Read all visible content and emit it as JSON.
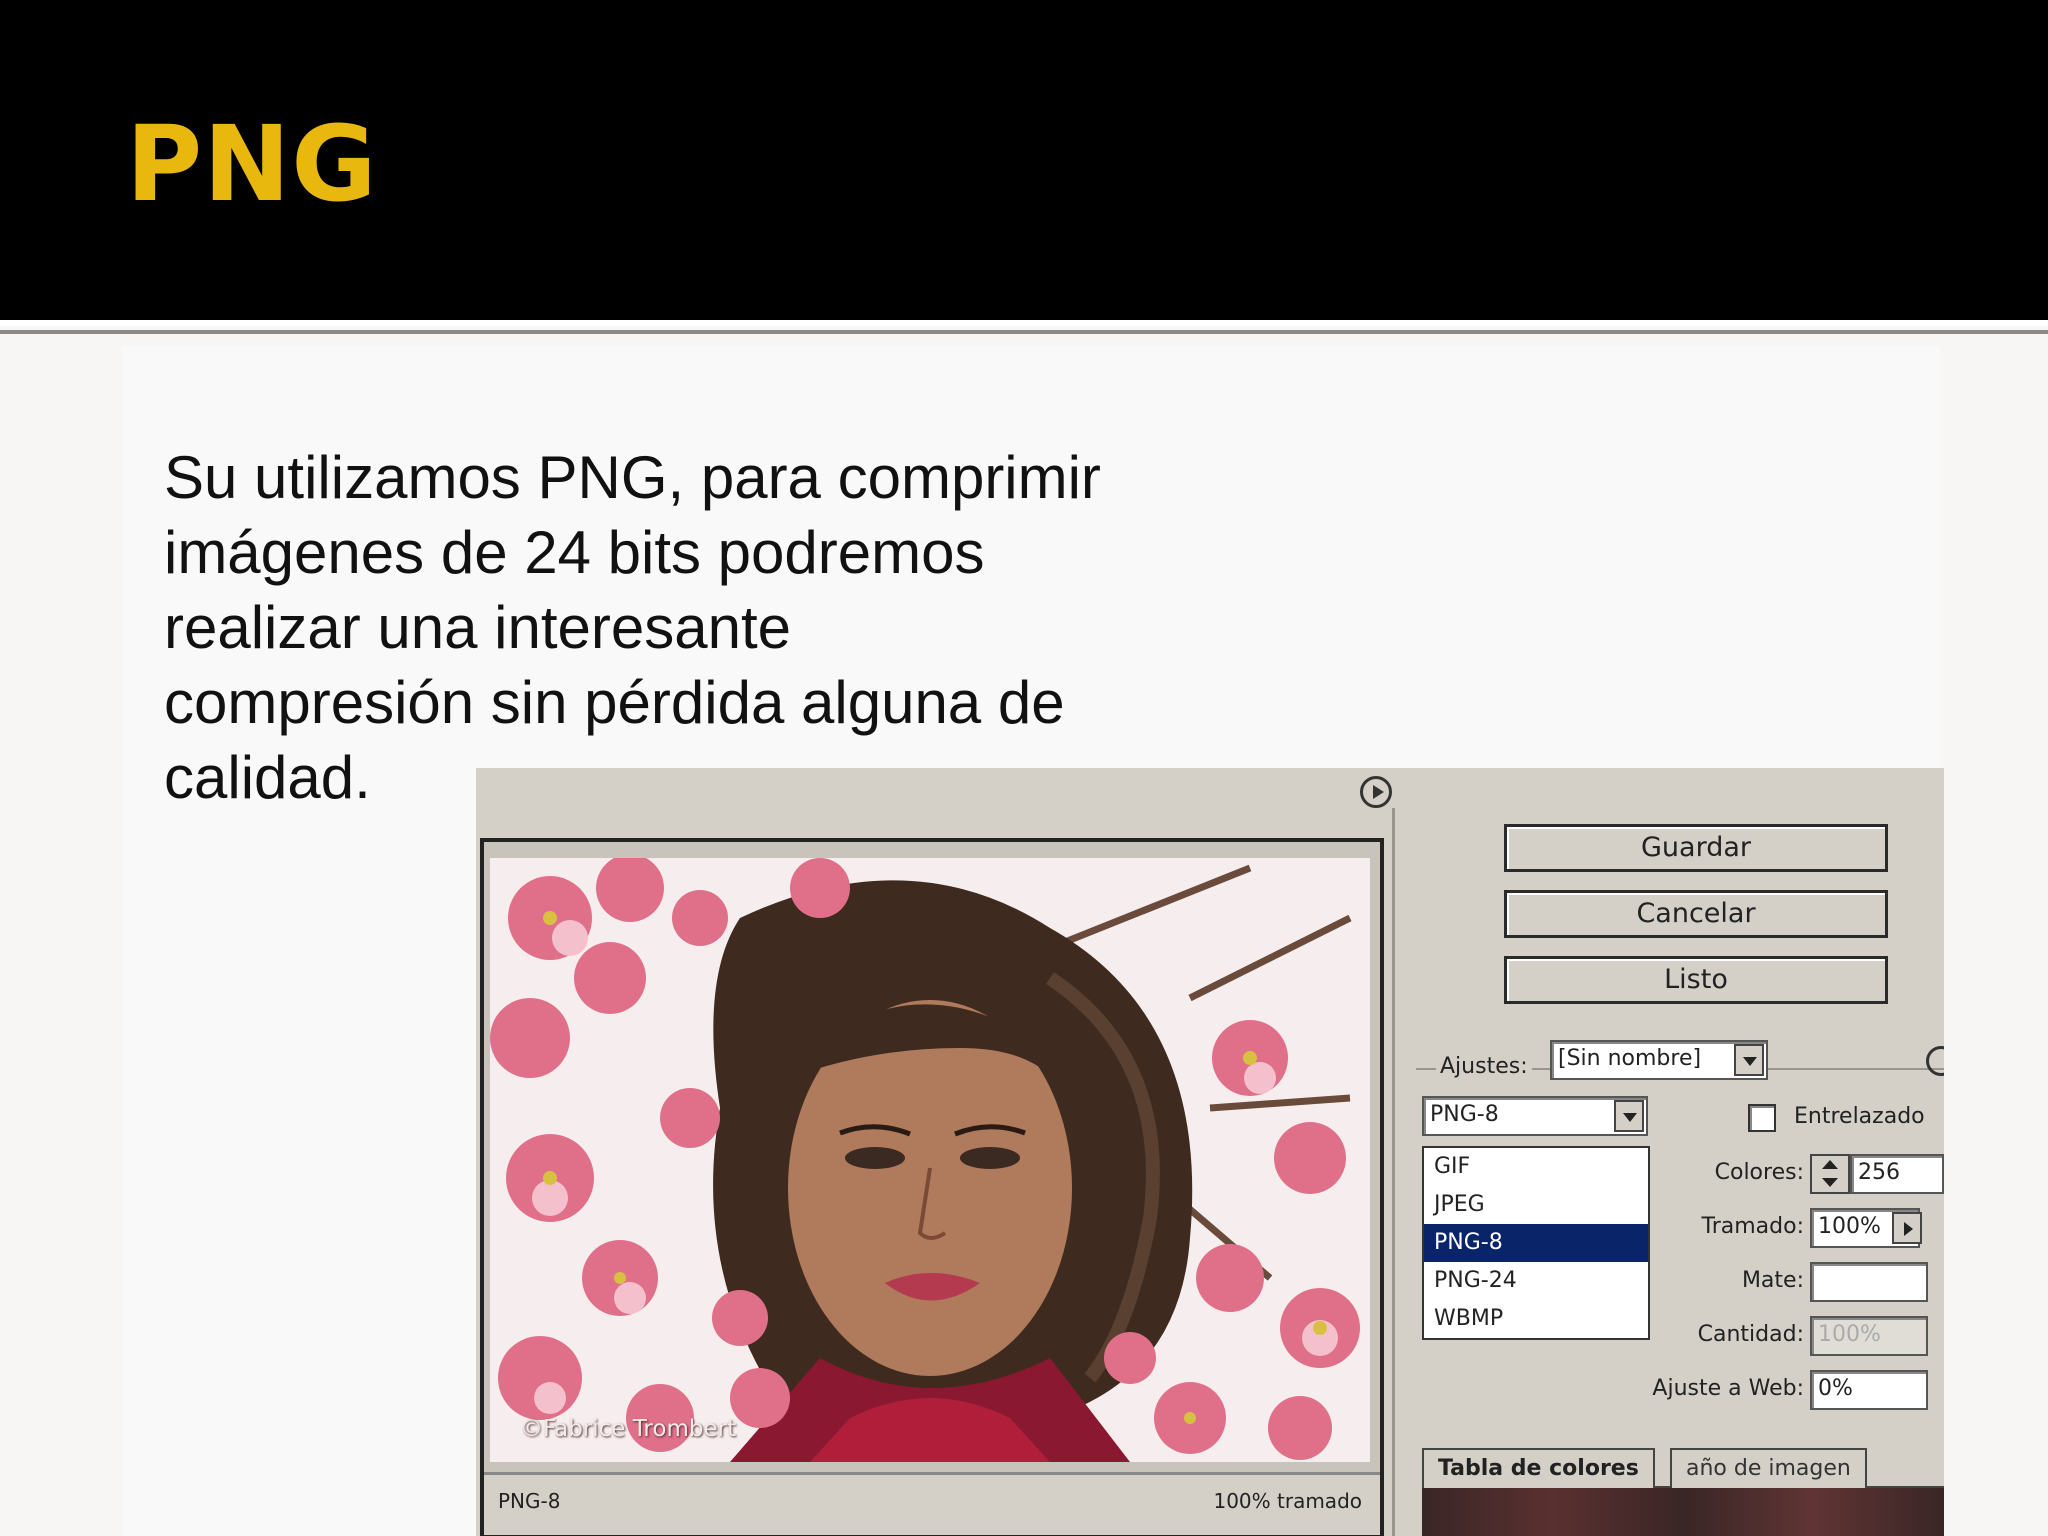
{
  "slide": {
    "title": "PNG",
    "body": "Su utilizamos PNG, para comprimir\nimágenes de 24 bits podremos\nrealizar una interesante\ncompresión sin pérdida alguna de\ncalidad."
  },
  "dialog": {
    "buttons": {
      "save": "Guardar",
      "cancel": "Cancelar",
      "done": "Listo"
    },
    "settings_label": "Ajustes:",
    "settings_value": "[Sin nombre]",
    "format_value": "PNG-8",
    "format_options": [
      "GIF",
      "JPEG",
      "PNG-8",
      "PNG-24",
      "WBMP"
    ],
    "selected_format": "PNG-8",
    "interlaced_label": "Entrelazado",
    "colors_label": "Colores:",
    "colors_value": "256",
    "dither_label": "Tramado:",
    "dither_value": "100%",
    "matte_label": "Mate:",
    "matte_value": "",
    "amount_label": "Cantidad:",
    "amount_value": "100%",
    "web_snap_label": "Ajuste a Web:",
    "web_snap_value": "0%",
    "tabs": {
      "color_table": "Tabla de colores",
      "image_size": "año de imagen"
    },
    "preview": {
      "watermark": "©Fabrice Trombert",
      "status_format": "PNG-8",
      "status_dither": "100% tramado"
    }
  },
  "colors": {
    "title": "#e8b80e",
    "header": "#000000",
    "selected": "#0a246a"
  }
}
